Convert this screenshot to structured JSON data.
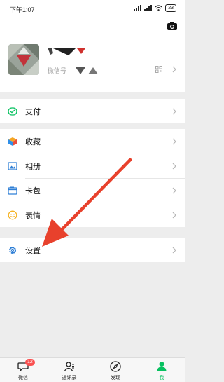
{
  "status_bar": {
    "time": "下午1:07",
    "battery": "23"
  },
  "profile": {
    "wechat_id_label": "微信号"
  },
  "menu": {
    "pay": {
      "label": "支付",
      "icon": "wechat-pay-icon"
    },
    "favorites": {
      "label": "收藏",
      "icon": "cube-icon"
    },
    "album": {
      "label": "相册",
      "icon": "image-icon"
    },
    "cards": {
      "label": "卡包",
      "icon": "wallet-icon"
    },
    "stickers": {
      "label": "表情",
      "icon": "smiley-icon"
    },
    "settings": {
      "label": "设置",
      "icon": "gear-icon"
    }
  },
  "tabs": [
    {
      "label": "微信",
      "icon": "chat-bubble-icon",
      "badge": "12"
    },
    {
      "label": "通讯录",
      "icon": "contacts-icon"
    },
    {
      "label": "发现",
      "icon": "compass-icon"
    },
    {
      "label": "我",
      "icon": "person-icon",
      "active": true
    }
  ],
  "colors": {
    "accent_green": "#07c160",
    "arrow_red": "#e8412c",
    "badge_red": "#fa5151"
  }
}
